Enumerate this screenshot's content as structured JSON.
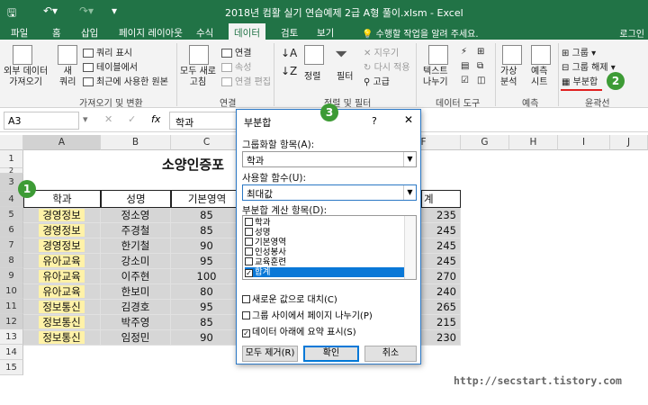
{
  "window": {
    "title": "2018년 컴활 실기 연습예제 2급 A형 풀이.xlsm - Excel"
  },
  "ribbon_tabs": [
    "파일",
    "홈",
    "삽입",
    "페이지 레이아웃",
    "수식",
    "데이터",
    "검토",
    "보기"
  ],
  "active_tab": "데이터",
  "tell_me": "수행할 작업을 알려 주세요.",
  "login": "로그인",
  "ribbon": {
    "external": "외부 데이터\n가져오기",
    "new_query": "새\n쿼리",
    "show_query": "쿼리 표시",
    "from_table": "테이블에서",
    "recent_sources": "최근에 사용한 원본",
    "group_get": "가져오기 및 변환",
    "refresh_all": "모두 새로\n고침",
    "connections": "연결",
    "properties": "속성",
    "edit_links": "연결 편집",
    "group_conn": "연결",
    "sort": "정렬",
    "filter": "필터",
    "clear": "지우기",
    "reapply": "다시 적용",
    "advanced": "고급",
    "group_sort": "정렬 및 필터",
    "text_to_columns": "텍스트\n나누기",
    "group_tools": "데이터 도구",
    "what_if": "가상\n분석",
    "forecast": "예측\n시트",
    "group_forecast": "예측",
    "group": "그룹",
    "ungroup": "그룹 해제",
    "subtotal": "부분합",
    "group_outline": "윤곽선"
  },
  "formula_bar": {
    "name_box": "A3",
    "fx": "fx",
    "content": "학과"
  },
  "columns": [
    "A",
    "B",
    "C",
    "D",
    "E",
    "F",
    "G",
    "H",
    "I",
    "J"
  ],
  "rows": [
    "1",
    "2",
    "3",
    "4",
    "5",
    "6",
    "7",
    "8",
    "9",
    "10",
    "11",
    "12",
    "13",
    "14",
    "15"
  ],
  "sheet_title": "소양인증포",
  "table": {
    "headers": [
      "학과",
      "성명",
      "기본영역"
    ],
    "last_header": "계",
    "rows": [
      [
        "경영정보",
        "정소영",
        "85",
        "235"
      ],
      [
        "경영정보",
        "주경철",
        "85",
        "245"
      ],
      [
        "경영정보",
        "한기철",
        "90",
        "245"
      ],
      [
        "유아교육",
        "강소미",
        "95",
        "245"
      ],
      [
        "유아교육",
        "이주현",
        "100",
        "270"
      ],
      [
        "유아교육",
        "한보미",
        "80",
        "240"
      ],
      [
        "정보통신",
        "김경호",
        "95",
        "265"
      ],
      [
        "정보통신",
        "박주영",
        "85",
        "215"
      ],
      [
        "정보통신",
        "임정민",
        "90",
        "230"
      ]
    ]
  },
  "dialog": {
    "title": "부분합",
    "help": "?",
    "close": "✕",
    "group_by_label": "그룹화할 항목(A):",
    "group_by_value": "학과",
    "function_label": "사용할 함수(U):",
    "function_value": "최대값",
    "add_to_label": "부분합 계산 항목(D):",
    "fields": [
      {
        "label": "학과",
        "checked": false
      },
      {
        "label": "성명",
        "checked": false
      },
      {
        "label": "기본영역",
        "checked": false
      },
      {
        "label": "인성봉사",
        "checked": false
      },
      {
        "label": "교육훈련",
        "checked": false
      },
      {
        "label": "합계",
        "checked": true
      }
    ],
    "replace_current": "새로운 값으로 대치(C)",
    "page_break": "그룹 사이에서 페이지 나누기(P)",
    "summary_below": "데이터 아래에 요약 표시(S)",
    "remove_all": "모두 제거(R)",
    "ok": "확인",
    "cancel": "취소"
  },
  "badges": [
    "1",
    "2",
    "3"
  ],
  "watermark": "http://secstart.tistory.com"
}
